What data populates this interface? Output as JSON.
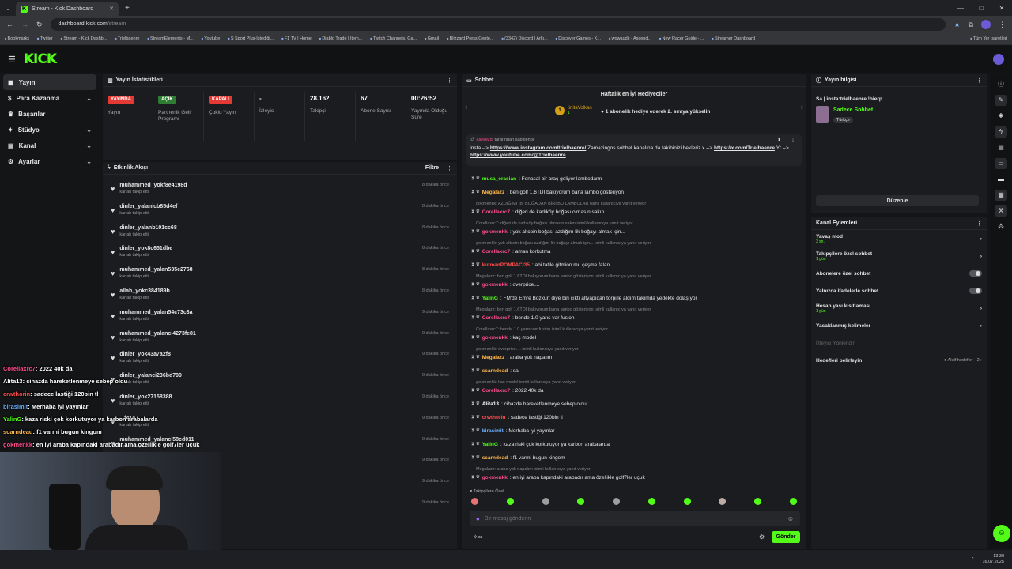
{
  "browser": {
    "tab_title": "Stream - Kick Dashboard",
    "url_host": "dashboard.kick.com",
    "url_path": "/stream",
    "bookmarks": [
      "Bookmarks",
      "Twitter",
      "Stream - Kick Dashb...",
      "Trielbaenre",
      "StreamElements - M...",
      "Youtube",
      "S Sport Plus-İstediği...",
      "F1 TV | Home",
      "Diablo Trade | Item...",
      "Twitch Channels, Ga...",
      "Gmail",
      "Blizzard Press Cente...",
      "(3342) Discord | Arkı...",
      "Discover Games - K...",
      "wowaudit - Ascend...",
      "New Racer Guide - ...",
      "Streamer Dashboard"
    ],
    "all_bookmarks": "Tüm Yer İşaretleri"
  },
  "sidebar": {
    "items": [
      {
        "label": "Yayın",
        "active": true
      },
      {
        "label": "Para Kazanma"
      },
      {
        "label": "Başarılar"
      },
      {
        "label": "Stüdyo"
      },
      {
        "label": "Kanal"
      },
      {
        "label": "Ayarlar"
      }
    ]
  },
  "stats": {
    "title": "Yayın İstatistikleri",
    "items": [
      {
        "badge": "YAYINDA",
        "badge_color": "#e53935",
        "label": "Yayın"
      },
      {
        "badge": "AÇIK",
        "badge_color": "#2e7d32",
        "label": "Partnerlik Gelir Programı"
      },
      {
        "badge": "KAPALI",
        "badge_color": "#e53935",
        "label": "Çoklu Yayın"
      },
      {
        "value": "-",
        "label": "İzleyici"
      },
      {
        "value": "28.162",
        "label": "Takipçi"
      },
      {
        "value": "67",
        "label": "Abone Sayısı"
      },
      {
        "value": "00:26:52",
        "label": "Yayında Olduğu Süre"
      }
    ]
  },
  "activity": {
    "title": "Etkinlik Akışı",
    "filter": "Filtre",
    "events": [
      {
        "name": "muhammed_yokf8e4198d",
        "sub": "kanalı takip etti",
        "time": "8 dakika önce"
      },
      {
        "name": "dinler_yalanicb85d4ef",
        "sub": "kanalı takip etti",
        "time": "8 dakika önce"
      },
      {
        "name": "dinler_yalanb101cc68",
        "sub": "kanalı takip etti",
        "time": "8 dakika önce"
      },
      {
        "name": "dinler_yok8c651dbe",
        "sub": "kanalı takip etti",
        "time": "8 dakika önce"
      },
      {
        "name": "muhammed_yalan535e2768",
        "sub": "kanalı takip etti",
        "time": "8 dakika önce"
      },
      {
        "name": "allah_yokc384189b",
        "sub": "kanalı takip etti",
        "time": "8 dakika önce"
      },
      {
        "name": "muhammed_yalan54c73c3a",
        "sub": "kanalı takip etti",
        "time": "9 dakika önce"
      },
      {
        "name": "muhammed_yalanci4273fe81",
        "sub": "kanalı takip etti",
        "time": "9 dakika önce"
      },
      {
        "name": "dinler_yok43a7a2f8",
        "sub": "kanalı takip etti",
        "time": "9 dakika önce"
      },
      {
        "name": "dinler_yalanci236bd799",
        "sub": "kanalı takip etti",
        "time": "9 dakika önce"
      },
      {
        "name": "dinler_yok27158388",
        "sub": "kanalı takip etti",
        "time": "9 dakika önce"
      },
      {
        "name": "...f41e",
        "sub": "kanalı takip etti",
        "time": "9 dakika önce"
      },
      {
        "name": "muhammed_yalanci58cd011",
        "sub": "kanalı takip etti",
        "time": "9 dakika önce"
      }
    ],
    "tail_times": [
      "9 dakika önce",
      "9 dakika önce",
      "9 dakika önce"
    ]
  },
  "overlay_chat": [
    {
      "user": "Corellaxrc7",
      "text": ": 2022 40k da",
      "color": "#ff4d8d"
    },
    {
      "user": "Alita13",
      "text": ": cihazda hareketlenmeye sebep oldu",
      "color": "#ffffff"
    },
    {
      "user": "crwthorin",
      "text": ": sadece lastiği 120bin tl",
      "color": "#ff4d4d"
    },
    {
      "user": "birasimit",
      "text": ": Merhaba iyi yayınlar",
      "color": "#6ab0ff"
    },
    {
      "user": "YalinG",
      "text": ": kaza riski çok korkutuyor ya karbon arabalarda",
      "color": "#53fc18"
    },
    {
      "user": "scarndead",
      "text": ": f1 varmi bugun kingom",
      "color": "#ffb74d"
    },
    {
      "user": "gokmenkk",
      "text": ": en iyi araba kapındaki arabadır ama özellikle golf7ler uçuk",
      "color": "#ff4d8d"
    }
  ],
  "chat": {
    "title": "Sohbet",
    "gift_title": "Haftalık en İyi Hediyeciler",
    "gift_user": "tinitaVolkan",
    "gift_rank": "1",
    "gift_count": "1",
    "gift_cta": "1 abonelik hediye ederek 2. sıraya yükselin",
    "pinned_by": "asysezgi",
    "pinned_by_suffix": "tarafından sabitlendi",
    "pinned_pre": "Insta -->",
    "pinned_link1": "https://www.instagram.com/trielbaenre/",
    "pinned_mid": "Zamazingos sohbet kanalına da takibinizi bekleriz",
    "pinned_x": "x -->",
    "pinned_link2": "https://x.com/Trielbaenre",
    "pinned_yt": "Yt -->",
    "pinned_link3": "https://www.youtube.com/@Trielbaenre",
    "messages": [
      {
        "type": "msg",
        "user": "musa_erasian",
        "color": "#53fc18",
        "text": ": Fenasal bir araç geliyor lambodann"
      },
      {
        "type": "msg",
        "user": "Megalazz",
        "color": "#ffb74d",
        "text": ": ben golf 1.6TDI bakıyorum bana lambo gösteriyon"
      },
      {
        "type": "reply",
        "text": "gokmenkk: AZDIĞIMI İBİ BOĞADAN BİRİ BU LAMBOLAR isimli kullanıcıya yanıt veriyor"
      },
      {
        "type": "msg",
        "user": "Corellaxrc7",
        "color": "#ff4d8d",
        "text": ": diğeri de kadıköy boğası olmasın sakın"
      },
      {
        "type": "reply",
        "text": "Corellaxrc7: diğeri de kadıköy boğası olmasın sakın isimli kullanıcıya yanıt veriyor"
      },
      {
        "type": "msg",
        "user": "gokmenkk",
        "color": "#ff4d8d",
        "text": ": yok altcoin boğası azdığım lik boğayı almak için..."
      },
      {
        "type": "reply",
        "text": "gokmenkk: yok altcoin boğası azdığım lik boğayı almak için... isimli kullanıcıya yanıt veriyor"
      },
      {
        "type": "msg",
        "user": "Corellaxrc7",
        "color": "#ff4d8d",
        "text": ": aman korkutma"
      },
      {
        "type": "msg",
        "user": "kutmanPOMPACI35",
        "color": "#ff4d4d",
        "text": ": abi tatile gitmion mu çeşme falan"
      },
      {
        "type": "reply",
        "text": "Megalazz: ben golf 1.6TDI bakıyorum bana lambo gösteriyon isimli kullanıcıya yanıt veriyor"
      },
      {
        "type": "msg",
        "user": "gokmenkk",
        "color": "#ff4d8d",
        "text": ": overprice...."
      },
      {
        "type": "msg",
        "user": "YalinG",
        "color": "#53fc18",
        "text": ": FM'de Emre Bozkurt diye biri çıktı altyapıdan torpille aldım takımda yedekte dolaşıyor"
      },
      {
        "type": "reply",
        "text": "Megalazz: ben golf 1.6TDI bakıyorum bana lambo gösteriyon isimli kullanıcıya yanıt veriyor"
      },
      {
        "type": "msg",
        "user": "Corellaxrc7",
        "color": "#ff4d8d",
        "text": ": bende 1.0 yarıs var fusion"
      },
      {
        "type": "reply",
        "text": "Corellaxrc7: bende 1.0 yarıs var fusion isimli kullanıcıya yanıt veriyor"
      },
      {
        "type": "msg",
        "user": "gokmenkk",
        "color": "#ff4d8d",
        "text": ": kaç model"
      },
      {
        "type": "reply",
        "text": "gokmenkk: overprice.... isimli kullanıcıya yanıt veriyor"
      },
      {
        "type": "msg",
        "user": "Megalazz",
        "color": "#ffb74d",
        "text": ": araba yok napalım"
      },
      {
        "type": "msg",
        "user": "scarndead",
        "color": "#ffb74d",
        "text": ": sa"
      },
      {
        "type": "reply",
        "text": "gokmenkk: kaç model isimli kullanıcıya yanıt veriyor"
      },
      {
        "type": "msg",
        "user": "Corellaxrc7",
        "color": "#ff4d8d",
        "text": ": 2022 40k da"
      },
      {
        "type": "msg",
        "user": "Alita13",
        "color": "#ffffff",
        "text": ": cihazda hareketlenmeye sebep oldu"
      },
      {
        "type": "msg",
        "user": "crwthorin",
        "color": "#ff4d4d",
        "text": ": sadece lastiği 120bin tl"
      },
      {
        "type": "msg",
        "user": "birasimit",
        "color": "#6ab0ff",
        "text": ": Merhaba iyi yayınlar"
      },
      {
        "type": "msg",
        "user": "YalinG",
        "color": "#53fc18",
        "text": ": kaza riski çok korkutuyor ya karbon arabalarda"
      },
      {
        "type": "msg",
        "user": "scarndead",
        "color": "#ffb74d",
        "text": ": f1 varmi bugun kingom"
      },
      {
        "type": "reply",
        "text": "Megalazz: araba yok napalım isimli kullanıcıya yanıt veriyor"
      },
      {
        "type": "msg",
        "user": "gokmenkk",
        "color": "#ff4d8d",
        "text": ": en iyi araba kapındaki arabadır ama özellikle golf7ler uçuk"
      }
    ],
    "followers_only": "Takipçilere Özel",
    "input_placeholder": "Bir mesaj gönderin",
    "send_label": "Gönder"
  },
  "stream_info": {
    "title": "Yayın bilgisi",
    "stream_title": "Sa | insta:trielbaenre !bierp",
    "category": "Sadece Sohbet",
    "language": "Türkçe",
    "edit_label": "Düzenle"
  },
  "channel_actions": {
    "title": "Kanal Eylemleri",
    "items": [
      {
        "label": "Yavaş mod",
        "sub": "3 sn.",
        "control": "chevron"
      },
      {
        "label": "Takipçilere özel sohbet",
        "sub": "1 gün",
        "control": "chevron"
      },
      {
        "label": "Abonelere özel sohbet",
        "sub": "",
        "control": "toggle"
      },
      {
        "label": "Yalnızca ifadelerle sohbet",
        "sub": "",
        "control": "toggle"
      },
      {
        "label": "Hesap yaşı kısıtlaması",
        "sub": "1 gün",
        "control": "chevron"
      },
      {
        "label": "Yasaklanmış kelimeler",
        "sub": "",
        "control": "chevron"
      }
    ],
    "viewer_manage": "İzleyici Yönlendir",
    "goals_label": "Hedefleri belirleyin",
    "goals_status": "Aktif hedefler - 2"
  },
  "taskbar": {
    "time": "13:39",
    "date": "16.07.2025"
  },
  "colors": {
    "accent": "#53fc18",
    "panel": "#1b1c1f",
    "bg": "#141517"
  }
}
